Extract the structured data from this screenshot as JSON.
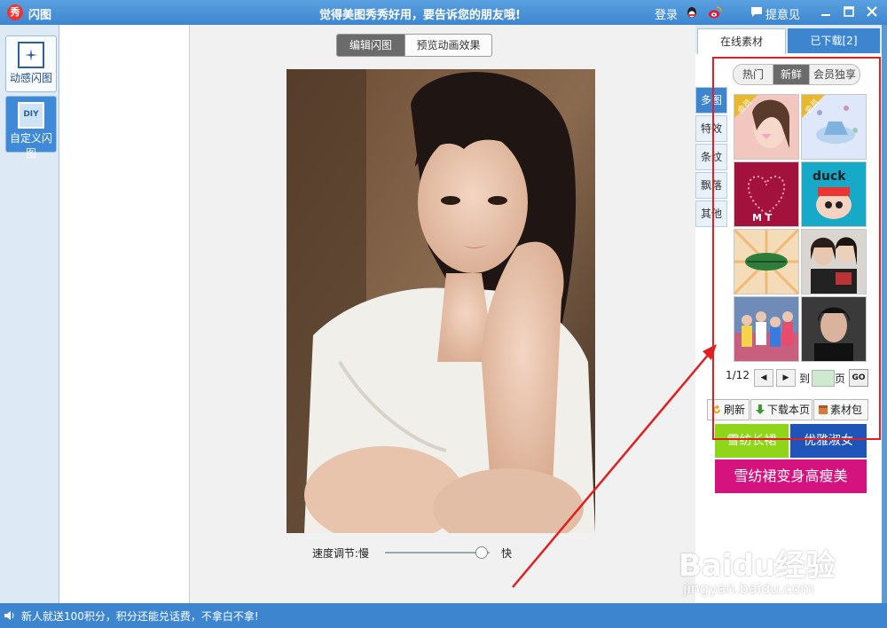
{
  "titlebar": {
    "logo_text": "秀",
    "app_name": "闪图",
    "slogan": "觉得美图秀秀好用，要告诉您的朋友哦!",
    "login": "登录",
    "feedback": "提意见"
  },
  "sidebar": {
    "items": [
      {
        "label": "动感闪图"
      },
      {
        "label": "自定义闪图",
        "icon_text": "DIY"
      }
    ]
  },
  "workspace": {
    "tabs": [
      {
        "label": "编辑闪图",
        "active": true
      },
      {
        "label": "预览动画效果",
        "active": false
      }
    ],
    "speed": {
      "label": "速度调节:",
      "slow": "慢",
      "fast": "快",
      "value": 0.9
    }
  },
  "right_panel": {
    "tabs": [
      {
        "label": "在线素材",
        "active": true
      },
      {
        "label": "已下载[2]",
        "active": false
      }
    ],
    "filters": [
      {
        "label": "热门",
        "active": false
      },
      {
        "label": "新鲜",
        "active": true
      },
      {
        "label": "会员独享",
        "active": false
      }
    ],
    "categories": [
      {
        "label": "多图",
        "active": true
      },
      {
        "label": "特效"
      },
      {
        "label": "条纹"
      },
      {
        "label": "飘落"
      },
      {
        "label": "其他"
      }
    ],
    "thumb_badges": [
      "会员",
      "会员"
    ],
    "duck_text": "duck",
    "mt_text": "M T",
    "pagination": {
      "current": "1/12",
      "goto_label": "到",
      "page_unit": "页",
      "go": "GO"
    },
    "actions": [
      {
        "label": "刷新"
      },
      {
        "label": "下载本页"
      },
      {
        "label": "素材包"
      }
    ],
    "ads": [
      {
        "label": "雪纺长裙",
        "color": "#8fd61b"
      },
      {
        "label": "优雅淑女",
        "color": "#1f55b8"
      },
      {
        "label": "雪纺裙变身高瘦美",
        "color": "#d4137f"
      }
    ]
  },
  "statusbar": {
    "text": "新人就送100积分，积分还能兑话费，不拿白不拿!"
  },
  "watermark": {
    "logo": "Baidu经验",
    "url": "jingyan.baidu.com"
  }
}
